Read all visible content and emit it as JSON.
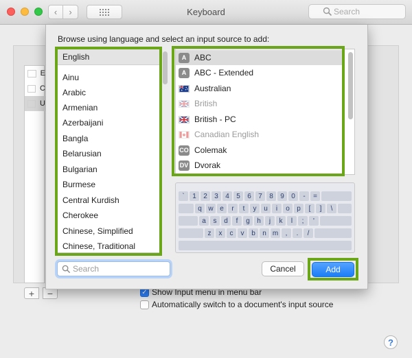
{
  "window": {
    "title": "Keyboard",
    "search_placeholder": "Search"
  },
  "sheet": {
    "instruction": "Browse using language and select an input source to add:",
    "languages": [
      {
        "label": "English",
        "selected": true
      },
      {
        "label": "Ainu"
      },
      {
        "label": "Arabic"
      },
      {
        "label": "Armenian"
      },
      {
        "label": "Azerbaijani"
      },
      {
        "label": "Bangla"
      },
      {
        "label": "Belarusian"
      },
      {
        "label": "Bulgarian"
      },
      {
        "label": "Burmese"
      },
      {
        "label": "Central Kurdish"
      },
      {
        "label": "Cherokee"
      },
      {
        "label": "Chinese, Simplified"
      },
      {
        "label": "Chinese, Traditional"
      }
    ],
    "sources": [
      {
        "label": "ABC",
        "icon": "A",
        "icon_type": "badge",
        "selected": true
      },
      {
        "label": "ABC - Extended",
        "icon": "A",
        "icon_type": "badge"
      },
      {
        "label": "Australian",
        "icon": "australia-flag-icon",
        "icon_type": "flag"
      },
      {
        "label": "British",
        "icon": "uk-flag-icon",
        "icon_type": "flag",
        "disabled": true
      },
      {
        "label": "British - PC",
        "icon": "uk-flag-icon",
        "icon_type": "flag"
      },
      {
        "label": "Canadian English",
        "icon": "canada-flag-icon",
        "icon_type": "flag",
        "disabled": true
      },
      {
        "label": "Colemak",
        "icon": "CO",
        "icon_type": "badge"
      },
      {
        "label": "Dvorak",
        "icon": "DV",
        "icon_type": "badge"
      }
    ],
    "keyboard_rows": [
      [
        "`",
        "1",
        "2",
        "3",
        "4",
        "5",
        "6",
        "7",
        "8",
        "9",
        "0",
        "-",
        "="
      ],
      [
        "q",
        "w",
        "e",
        "r",
        "t",
        "y",
        "u",
        "i",
        "o",
        "p",
        "[",
        "]",
        "\\"
      ],
      [
        "a",
        "s",
        "d",
        "f",
        "g",
        "h",
        "j",
        "k",
        "l",
        ";",
        "'"
      ],
      [
        "z",
        "x",
        "c",
        "v",
        "b",
        "n",
        "m",
        ",",
        ".",
        "/"
      ]
    ],
    "search_placeholder": "Search",
    "cancel_label": "Cancel",
    "add_label": "Add"
  },
  "background": {
    "input_sources": [
      {
        "label": "E",
        "icon": "uk-flag-icon"
      },
      {
        "label": "C",
        "icon": "canada-flag-icon"
      },
      {
        "label": "U",
        "icon": "us-flag-icon",
        "selected": true
      }
    ],
    "plus_label": "+",
    "minus_label": "−",
    "show_menu_label": "Show Input menu in menu bar",
    "show_menu_checked": true,
    "auto_switch_label": "Automatically switch to a document's input source",
    "auto_switch_checked": false,
    "help_label": "?"
  },
  "colors": {
    "highlight_border": "#6aa51a",
    "accent": "#1c7df5"
  }
}
